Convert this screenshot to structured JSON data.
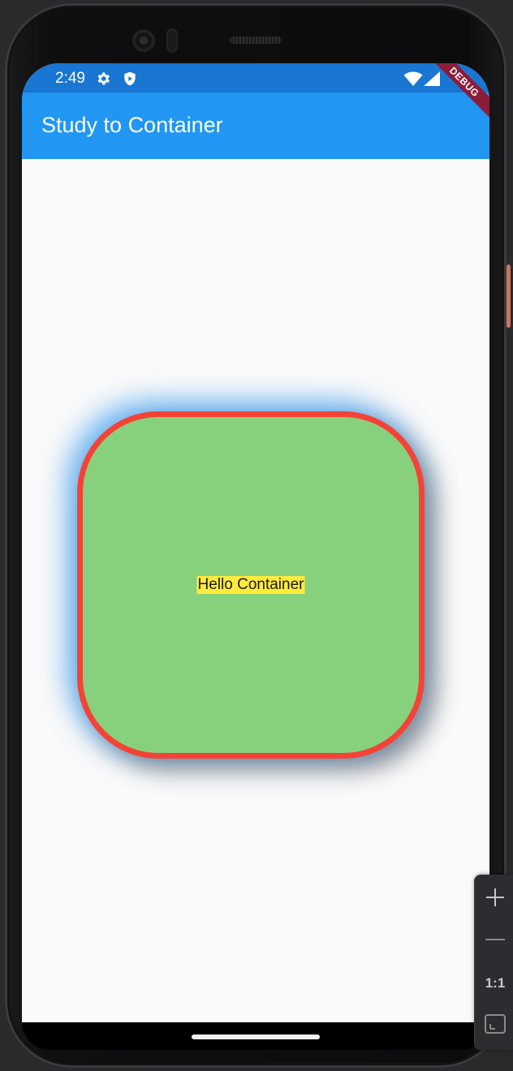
{
  "status_bar": {
    "time": "2:49",
    "icons": [
      "gear-icon",
      "shield-icon",
      "wifi-icon",
      "cellular-signal-icon"
    ]
  },
  "app_bar": {
    "title": "Study to Container",
    "debug_banner": "DEBUG"
  },
  "container": {
    "text": "Hello Container",
    "colors": {
      "fill": "#88d17c",
      "border": "#f44336",
      "label_background": "#ffeb3b",
      "shadow_primary": "#2196f3"
    }
  },
  "emulator_controls": {
    "zoom_actual_label": "1:1",
    "icons": [
      "zoom-in-icon",
      "zoom-out-icon",
      "fit-screen-icon"
    ]
  },
  "colors": {
    "status_bar": "#1976d2",
    "app_bar": "#2196f3",
    "background": "#fafafa"
  }
}
